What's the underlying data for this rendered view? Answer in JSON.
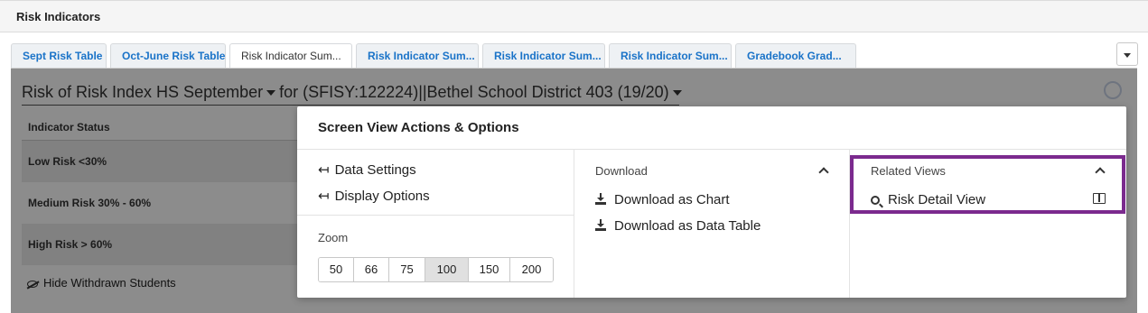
{
  "header": {
    "title": "Risk Indicators"
  },
  "tabs": [
    {
      "label": "Sept Risk Table",
      "active": false
    },
    {
      "label": "Oct-June Risk Table",
      "active": false
    },
    {
      "label": "Risk Indicator Sum...",
      "active": true
    },
    {
      "label": "Risk Indicator Sum...",
      "active": false
    },
    {
      "label": "Risk Indicator Sum...",
      "active": false
    },
    {
      "label": "Risk Indicator Sum...",
      "active": false
    },
    {
      "label": "Gradebook Grad...",
      "active": false
    }
  ],
  "report": {
    "title_part1": "Risk of Risk Index HS September",
    "title_part2": "for (SFISY:122224)||Bethel School District 403 (19/20)"
  },
  "table": {
    "header": "Indicator Status",
    "rows": [
      "Low Risk <30%",
      "Medium Risk 30% - 60%",
      "High Risk > 60%"
    ]
  },
  "hide_withdrawn": "Hide Withdrawn Students",
  "modal": {
    "title": "Screen View Actions & Options",
    "actions": {
      "data_settings": "Data Settings",
      "display_options": "Display Options",
      "arrow_glyph": "↤"
    },
    "zoom": {
      "label": "Zoom",
      "options": [
        "50",
        "66",
        "75",
        "100",
        "150",
        "200"
      ],
      "selected": "100"
    },
    "download": {
      "label": "Download",
      "chart": "Download as Chart",
      "data_table": "Download as Data Table"
    },
    "related": {
      "label": "Related Views",
      "item": "Risk Detail View"
    }
  },
  "colors": {
    "tab_link": "#1a73c8",
    "highlight_border": "#7b2a8e",
    "overlay": "rgba(0,0,0,0.45)"
  }
}
